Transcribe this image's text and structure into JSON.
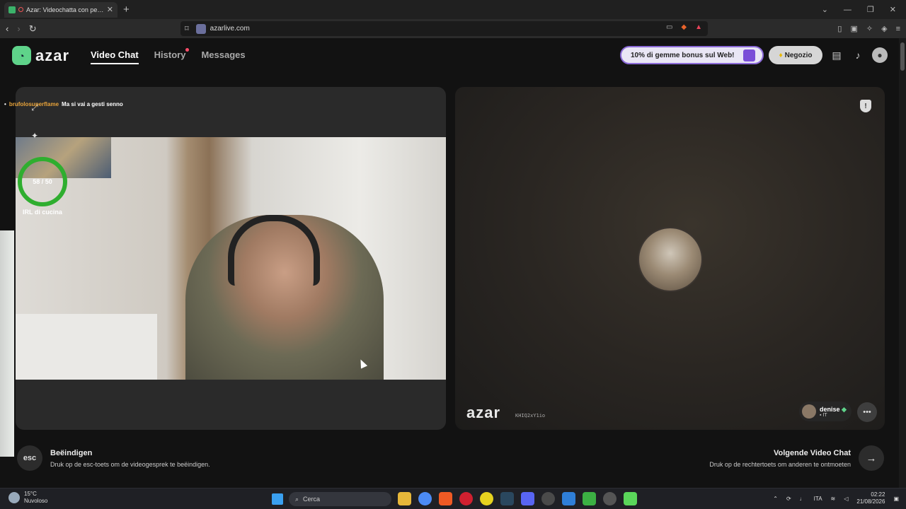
{
  "browser": {
    "tab_title": "Azar: Videochatta con persone",
    "tab_close": "✕",
    "new_tab": "+",
    "url": "azarlive.com",
    "window_controls": [
      "⌄",
      "—",
      "❐",
      "✕"
    ]
  },
  "header": {
    "logo_mark": "◔",
    "logo_text": "azar",
    "nav": [
      {
        "label": "Video Chat",
        "active": true
      },
      {
        "label": "History",
        "active": false,
        "has_dot": true
      },
      {
        "label": "Messages",
        "active": false
      }
    ],
    "promo": "10% di gemme bonus sul Web!",
    "shop_label": "Negozio"
  },
  "left_panel": {
    "chat_user": "brufolosuperflame",
    "chat_message": "Ma si vai a gesti senno",
    "goal_progress": "58 / 50",
    "goal_label": "IRL di cucina"
  },
  "right_panel": {
    "watermark": "azar",
    "session_id": "KHIQ2xY1io",
    "partner_name": "denise",
    "partner_country": "IT"
  },
  "footer": {
    "esc_key": "esc",
    "end_title": "Beëindigen",
    "end_desc": "Druk op de esc-toets om de videogesprek te beëindigen.",
    "next_title": "Volgende Video Chat",
    "next_desc": "Druk op de rechtertoets om anderen te ontmoeten"
  },
  "taskbar": {
    "temperature": "15°C",
    "weather": "Nuvoloso",
    "search_placeholder": "Cerca",
    "language": "ITA",
    "time": "02:22",
    "date": "21/08/2026"
  },
  "colors": {
    "accent_green": "#5fd38a",
    "goal_ring": "#2fae2f",
    "promo_border": "#8b6ad8",
    "history_dot": "#ff4d6a",
    "chat_username": "#e8a33a"
  }
}
